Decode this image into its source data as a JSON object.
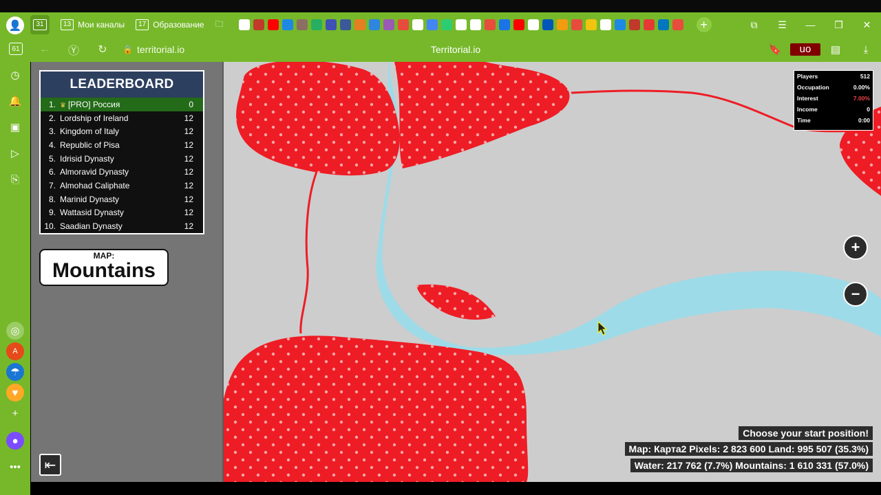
{
  "browser": {
    "tabs": [
      {
        "count": "13",
        "label": "Мои каналы"
      },
      {
        "count": "17",
        "label": "Образование"
      }
    ],
    "pinned_count": "31",
    "sidebar_count": "61",
    "url": "territorial.io",
    "page_title": "Territorial.io",
    "favicon_colors": [
      "#ffffff",
      "#c0392b",
      "#ff0000",
      "#1e88e5",
      "#8d6e63",
      "#27ae60",
      "#3f51b5",
      "#3b5998",
      "#e67e22",
      "#2e86de",
      "#9b59b6",
      "#e74c3c",
      "#ffffff",
      "#4285f4",
      "#2ecc71",
      "#ffffff",
      "#ffffff",
      "#e74c3c",
      "#1a73e8",
      "#ff0000",
      "#ffffff",
      "#0057b7",
      "#f39c12",
      "#e74c3c",
      "#f1c40f",
      "#ffffff",
      "#1e88e5",
      "#c0392b",
      "#e53935",
      "#0277bd",
      "#e74c3c"
    ]
  },
  "leaderboard": {
    "title": "LEADERBOARD",
    "rows": [
      {
        "rank": "1.",
        "name": "[PRO] Россия",
        "score": "0",
        "self": true
      },
      {
        "rank": "2.",
        "name": "Lordship of Ireland",
        "score": "12"
      },
      {
        "rank": "3.",
        "name": "Kingdom of Italy",
        "score": "12"
      },
      {
        "rank": "4.",
        "name": "Republic of Pisa",
        "score": "12"
      },
      {
        "rank": "5.",
        "name": "Idrisid Dynasty",
        "score": "12"
      },
      {
        "rank": "6.",
        "name": "Almoravid Dynasty",
        "score": "12"
      },
      {
        "rank": "7.",
        "name": "Almohad Caliphate",
        "score": "12"
      },
      {
        "rank": "8.",
        "name": "Marinid Dynasty",
        "score": "12"
      },
      {
        "rank": "9.",
        "name": "Wattasid Dynasty",
        "score": "12"
      },
      {
        "rank": "10.",
        "name": "Saadian Dynasty",
        "score": "12"
      }
    ]
  },
  "map_badge": {
    "label": "MAP:",
    "value": "Mountains"
  },
  "stats": [
    {
      "label": "Players",
      "value": "512"
    },
    {
      "label": "Occupation",
      "value": "0.00%"
    },
    {
      "label": "Interest",
      "value": "7.00%",
      "accent": "#ee4444"
    },
    {
      "label": "Income",
      "value": "0"
    },
    {
      "label": "Time",
      "value": "0:00"
    }
  ],
  "zoom": {
    "in": "+",
    "out": "−"
  },
  "info": {
    "prompt": "Choose your start position!",
    "line1": "Map: Карта2   Pixels: 2 823 600   Land: 995 507 (35.3%)",
    "line2": "Water: 217 762 (7.7%)   Mountains: 1 610 331 (57.0%)"
  },
  "colors": {
    "territory": "#ee1c25",
    "water": "#9edbe8",
    "land": "#cdcdcd",
    "browser": "#76b82a"
  }
}
